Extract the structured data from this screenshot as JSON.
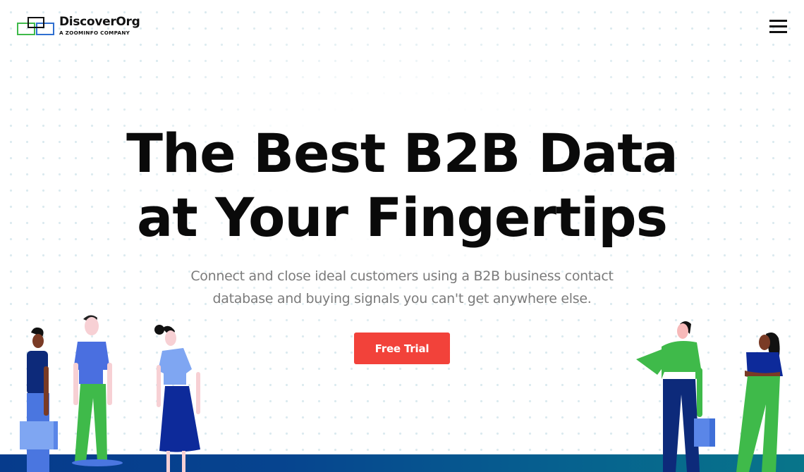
{
  "header": {
    "logo": {
      "name": "DiscoverOrg",
      "tagline": "A ZOOMINFO COMPANY",
      "icon": "overlapping-squares-logo-icon",
      "colors": {
        "green": "#3fba4a",
        "black": "#111111",
        "blue": "#2f6fd0"
      }
    },
    "menu_icon": "hamburger-menu-icon"
  },
  "hero": {
    "headline_line1": "The Best B2B Data",
    "headline_line2": "at Your Fingertips",
    "subtitle_line1": "Connect and close ideal customers using a B2B business contact",
    "subtitle_line2": "database and buying signals you can't get anywhere else.",
    "cta_label": "Free Trial"
  },
  "colors": {
    "cta": "#f2423a",
    "headline": "#0a0a0a",
    "subtitle": "#7b7b7b",
    "floor_start": "#063b8c",
    "floor_end": "#08758a"
  },
  "illustration": {
    "figures": [
      "man-with-briefcase-left",
      "man-green-pants",
      "woman-blue-skirt",
      "man-green-shirt-with-briefcase",
      "woman-arms-crossed"
    ]
  }
}
